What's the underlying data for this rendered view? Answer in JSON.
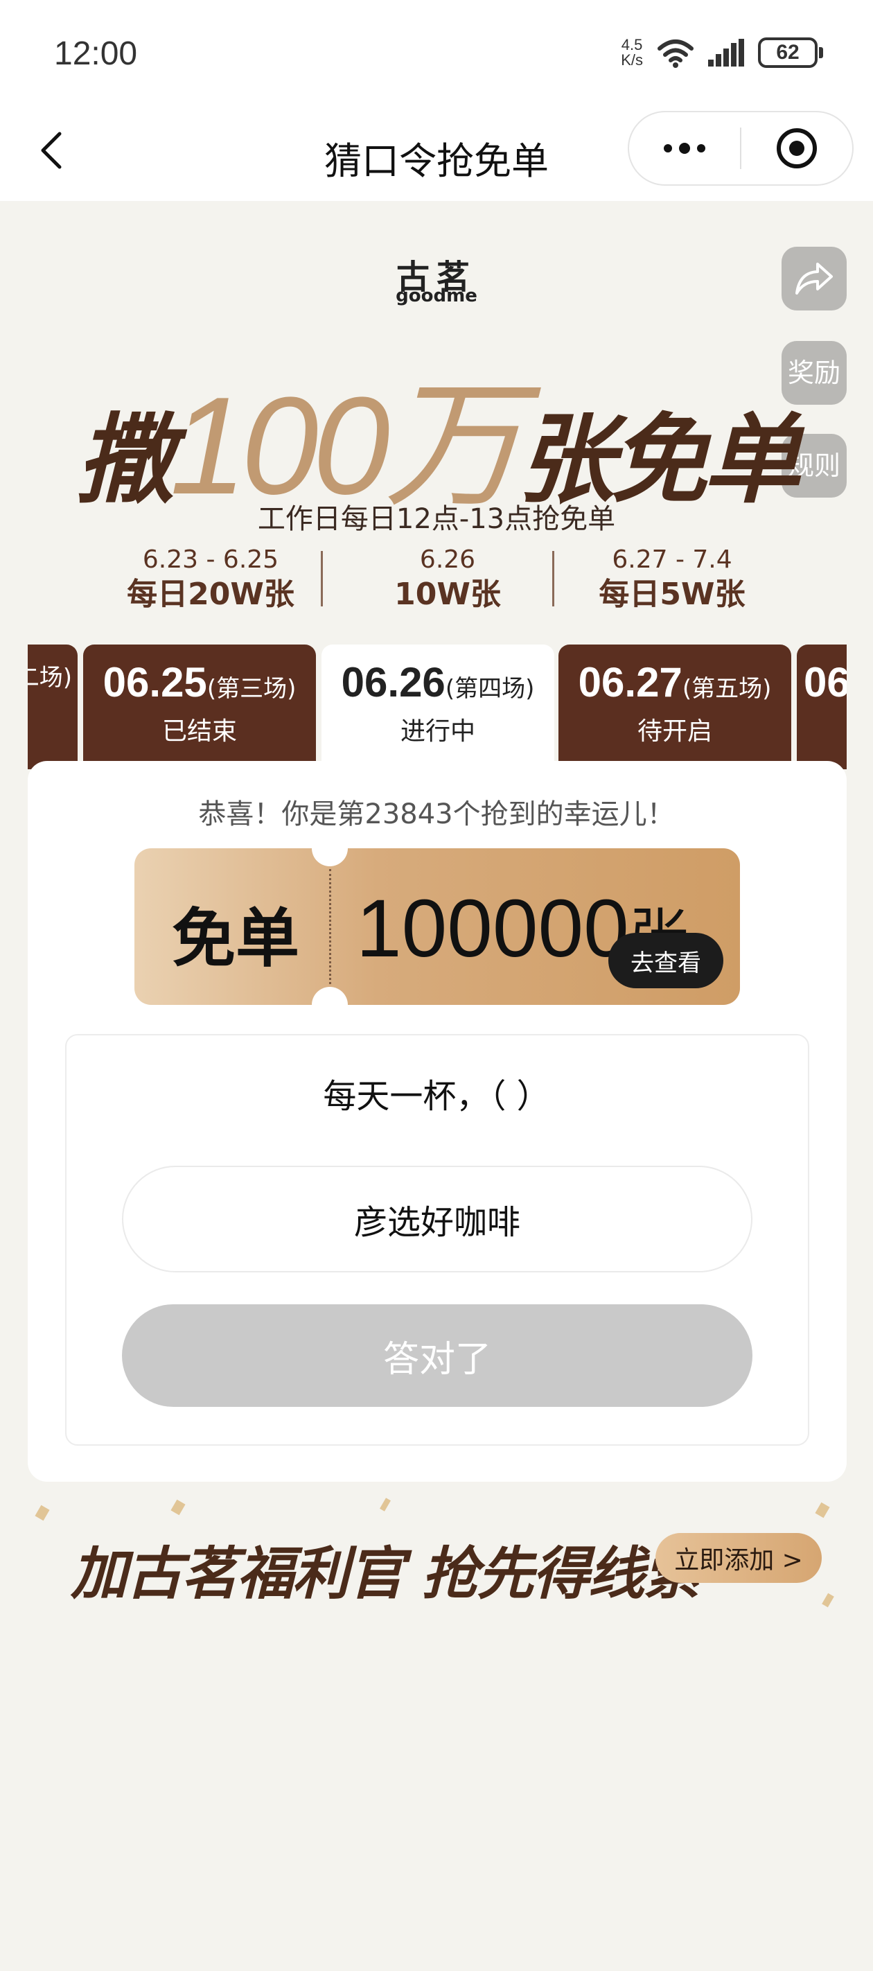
{
  "status_bar": {
    "time": "12:00",
    "net_speed_value": "4.5",
    "net_speed_unit": "K/s",
    "battery": "62",
    "icons": [
      "wifi-icon",
      "signal-icon",
      "battery-icon"
    ]
  },
  "nav": {
    "back_icon": "chevron-left-icon",
    "title": "猜口令抢免单",
    "more_icon": "more-dots-icon",
    "close_icon": "target-close-icon"
  },
  "hero": {
    "logo_cn": "古茗",
    "logo_en": "goodme",
    "headline_prefix": "撒",
    "headline_number": "100万",
    "headline_suffix": "张免单",
    "subline": "工作日每日12点-13点抢免单",
    "schedule": [
      {
        "dates": "6.23 - 6.25",
        "count": "每日20W张"
      },
      {
        "dates": "6.26",
        "count": "10W张"
      },
      {
        "dates": "6.27 - 7.4",
        "count": "每日5W张"
      }
    ]
  },
  "side_buttons": {
    "share_icon": "share-icon",
    "reward": "奖励",
    "rules": "规则"
  },
  "sessions": {
    "prev_partial": "二场)",
    "items": [
      {
        "date": "06.25",
        "session": "(第三场)",
        "status": "已结束"
      },
      {
        "date": "06.26",
        "session": "(第四场)",
        "status": "进行中"
      },
      {
        "date": "06.27",
        "session": "(第五场)",
        "status": "待开启"
      }
    ],
    "next_partial": "06"
  },
  "card": {
    "congrats": "恭喜！你是第23843个抢到的幸运儿！",
    "ticket_label": "免单",
    "ticket_count": "100000",
    "ticket_unit": "张",
    "view_button": "去查看",
    "question": "每天一杯，（ ）",
    "answer": "彦选好咖啡",
    "submit": "答对了"
  },
  "banner": {
    "text": "加古茗福利官 抢先得线索",
    "button": "立即添加 >"
  },
  "colors": {
    "brand_brown": "#5b2f20",
    "gold": "#c19a72",
    "background": "#f4f3ee",
    "disabled_button": "#c9c9c9"
  }
}
